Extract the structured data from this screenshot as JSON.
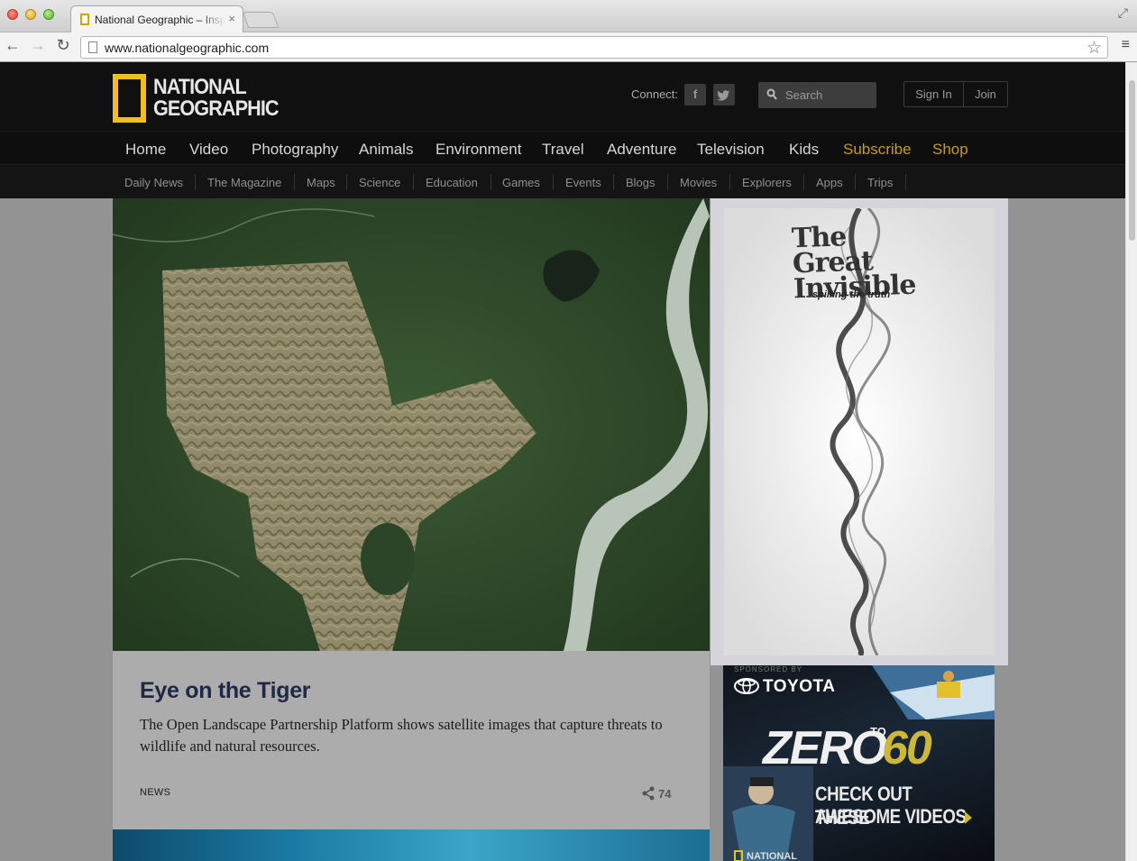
{
  "browser": {
    "tab_title": "National Geographic – Inspiring People to Care About the Planet",
    "tab_close": "×",
    "url": "www.nationalgeographic.com",
    "back_glyph": "←",
    "forward_glyph": "→",
    "reload_glyph": "↻",
    "star_glyph": "☆",
    "menu_glyph": "≡",
    "fullscreen_glyph": "⤢"
  },
  "header": {
    "logo_line1": "NATIONAL",
    "logo_line2": "GEOGRAPHIC",
    "connect_label": "Connect:",
    "facebook": "f",
    "twitter": "t",
    "search_placeholder": "Search",
    "sign_in": "Sign In",
    "join": "Join"
  },
  "main_nav": [
    "Home",
    "Video",
    "Photography",
    "Animals",
    "Environment",
    "Travel",
    "Adventure",
    "Television",
    "Kids",
    "Subscribe",
    "Shop"
  ],
  "sub_nav": [
    "Daily News",
    "The Magazine",
    "Maps",
    "Science",
    "Education",
    "Games",
    "Events",
    "Blogs",
    "Movies",
    "Explorers",
    "Apps",
    "Trips"
  ],
  "article": {
    "title": "Eye on the Tiger",
    "description": "The Open Landscape Partnership Platform shows satellite images that capture threats to wildlife and natural resources.",
    "category": "NEWS",
    "share_count": "74"
  },
  "ad_primary": {
    "title_line1": "The",
    "title_line2": "Great",
    "title_line3": "Invisible",
    "tagline": "spilling the truth"
  },
  "ad_secondary": {
    "sponsor": "SPONSORED BY",
    "brand": "TOYOTA",
    "zero": "ZERO",
    "to": "TO",
    "sixty": "60",
    "cta_line1": "CHECK OUT THESE",
    "cta_line2": "AWESOME VIDEOS",
    "footer": "NATIONAL"
  },
  "colors": {
    "accent_gold": "#c99a1e",
    "logo_yellow": "#f2be1b",
    "header_bg": "#101010",
    "title_navy": "#1f2846"
  }
}
